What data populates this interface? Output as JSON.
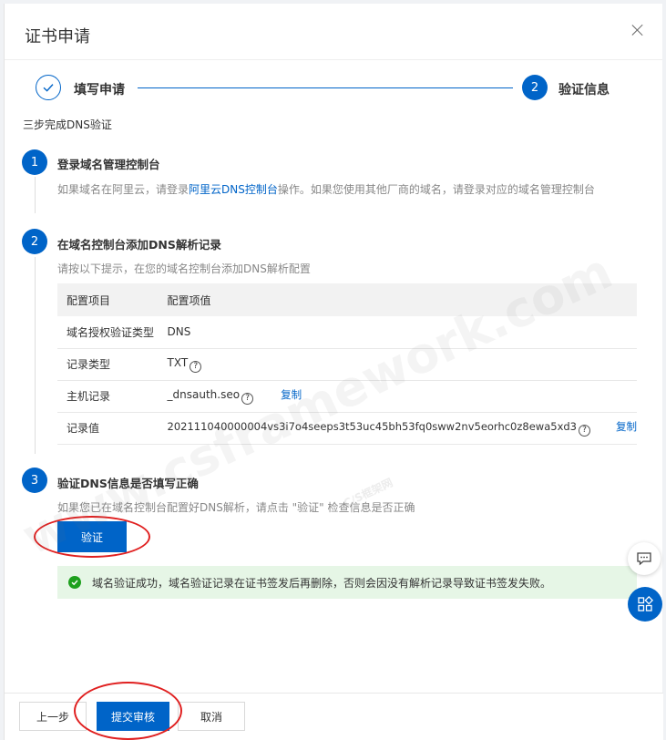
{
  "dialog": {
    "title": "证书申请"
  },
  "steps": {
    "step1_label": "填写申请",
    "step2_number": "2",
    "step2_label": "验证信息"
  },
  "subtitle": "三步完成DNS验证",
  "section1": {
    "number": "1",
    "title": "登录域名管理控制台",
    "desc_before": "如果域名在阿里云，请登录",
    "desc_link": "阿里云DNS控制台",
    "desc_after": "操作。如果您使用其他厂商的域名，请登录对应的域名管理控制台"
  },
  "section2": {
    "number": "2",
    "title": "在域名控制台添加DNS解析记录",
    "desc": "请按以下提示，在您的域名控制台添加DNS解析配置",
    "table": {
      "headers": [
        "配置项目",
        "配置项值"
      ],
      "rows": [
        {
          "label": "域名授权验证类型",
          "value": "DNS"
        },
        {
          "label": "记录类型",
          "value": "TXT"
        },
        {
          "label": "主机记录",
          "value": "_dnsauth.seo",
          "copy": "复制"
        },
        {
          "label": "记录值",
          "value": "202111040000004vs3i7o4seeps3t53uc45bh53fq0sww2nv5eorhc0z8ewa5xd3",
          "copy": "复制"
        }
      ]
    }
  },
  "section3": {
    "number": "3",
    "title": "验证DNS信息是否填写正确",
    "desc": "如果您已在域名控制台配置好DNS解析，请点击 \"验证\" 检查信息是否正确",
    "verify_button": "验证"
  },
  "success_message": "域名验证成功，域名验证记录在证书签发后再删除，否则会因没有解析记录导致证书签发失败。",
  "footer": {
    "prev_button": "上一步",
    "submit_button": "提交审核",
    "cancel_button": "取消"
  },
  "watermark": {
    "main": "www.csframework.com",
    "sub": "C/S框架网"
  },
  "colors": {
    "primary": "#0064c8",
    "success_bg": "#e6f6e6",
    "success_icon": "#1ea01e",
    "annotation_ring": "#e02020"
  }
}
